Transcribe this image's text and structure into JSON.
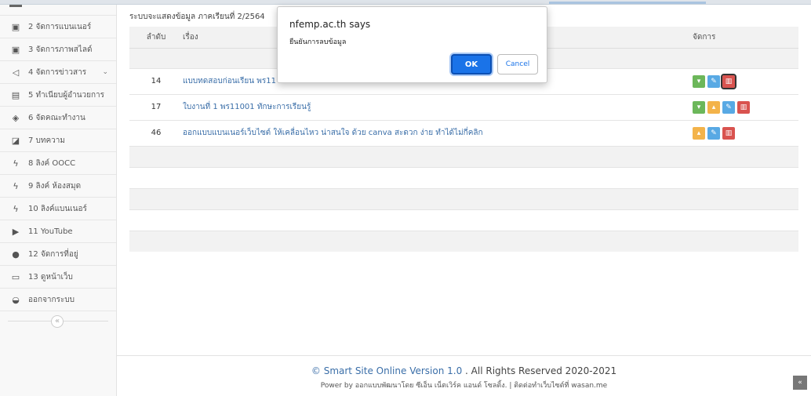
{
  "sidebar": {
    "items": [
      {
        "icon": "image-icon",
        "glyph": "▣",
        "label": "2 จัดการแบนเนอร์"
      },
      {
        "icon": "picture-icon",
        "glyph": "▣",
        "label": "3 จัดการภาพสไลด์"
      },
      {
        "icon": "megaphone-icon",
        "glyph": "◁",
        "label": "4 จัดการข่าวสาร",
        "caret": "⌄"
      },
      {
        "icon": "card-icon",
        "glyph": "▤",
        "label": "5 ทำเนียบผู้อำนวยการ"
      },
      {
        "icon": "eye-slash-icon",
        "glyph": "◈",
        "label": "6 จัดคณะทำงาน"
      },
      {
        "icon": "book-icon",
        "glyph": "◪",
        "label": "7 บทความ"
      },
      {
        "icon": "bolt-icon",
        "glyph": "ϟ",
        "label": "8 ลิงค์ OOCC"
      },
      {
        "icon": "bolt-icon",
        "glyph": "ϟ",
        "label": "9 ลิงค์ ห้องสมุด"
      },
      {
        "icon": "bolt-icon",
        "glyph": "ϟ",
        "label": "10 ลิงค์แบนเนอร์"
      },
      {
        "icon": "youtube-icon",
        "glyph": "▶",
        "label": "11 YouTube"
      },
      {
        "icon": "map-marker-icon",
        "glyph": "●",
        "label": "12 จัดการที่อยู่"
      },
      {
        "icon": "monitor-icon",
        "glyph": "▭",
        "label": "13 ดูหน้าเว็บ"
      },
      {
        "icon": "unlock-icon",
        "glyph": "◒",
        "label": "ออกจากระบบ"
      }
    ],
    "collapse_glyph": "«"
  },
  "main": {
    "caption": "ระบบจะแสดงข้อมูล ภาคเรียนที่ 2/2564",
    "columns": {
      "num": "ลำดับ",
      "title": "เรื่อง",
      "manage": "จัดการ"
    },
    "rows": [
      {
        "num": "14",
        "title": "แบบทดสอบก่อนเรียน พร11"
      },
      {
        "num": "17",
        "title": "ใบงานที่ 1 พร11001 ทักษะการเรียนรู้"
      },
      {
        "num": "46",
        "title": "ออกแบบแบนเนอร์เว็บไซต์ ให้เคลื่อนไหว น่าสนใจ ด้วย canva สะดวก ง่าย ทำได้ไม่กี่คลิก"
      }
    ]
  },
  "dialog": {
    "title": "nfemp.ac.th says",
    "message": "ยืนยันการลบข้อมูล",
    "ok": "OK",
    "cancel": "Cancel"
  },
  "footer": {
    "brand": "© Smart Site Online Version 1.0",
    "rights": " . All Rights Reserved 2020-2021",
    "power": "Power by ออกแบบพัฒนาโดย ซีเอ็น เน็ตเวิร์ค แอนด์ โซลติ้ง. | ติดต่อทำเว็บไซต์ที่ wasan.me",
    "totop_glyph": "«"
  },
  "colors": {
    "green": "#6cb75a",
    "orange": "#f3b34a",
    "blue": "#58a9e4",
    "red": "#d9534f",
    "link": "#3a6ea8"
  }
}
